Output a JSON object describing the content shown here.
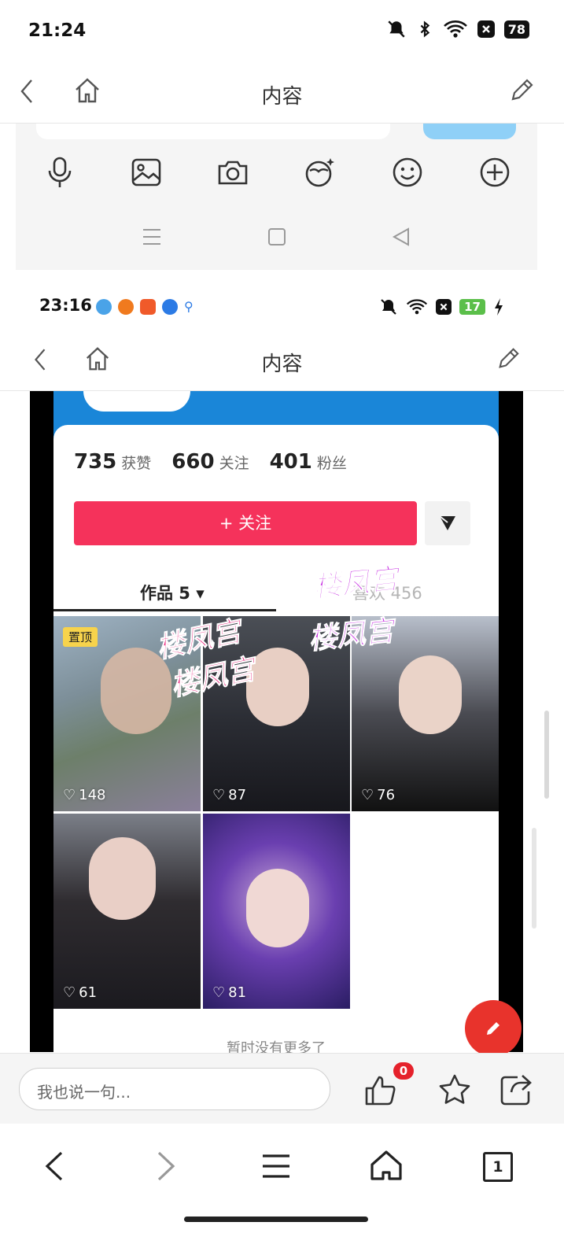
{
  "status_bar": {
    "time": "21:24",
    "battery": "78"
  },
  "top_nav": {
    "title": "内容"
  },
  "embedded_screenshot": {
    "status_bar": {
      "time": "23:16",
      "battery": "17"
    },
    "top_nav": {
      "title": "内容"
    },
    "profile": {
      "stats": [
        {
          "value": "735",
          "label": "获赞"
        },
        {
          "value": "660",
          "label": "关注"
        },
        {
          "value": "401",
          "label": "粉丝"
        }
      ],
      "follow_button": "+ 关注",
      "tabs": [
        {
          "label": "作品 5 ▾"
        },
        {
          "label": "喜欢 456"
        }
      ],
      "pinned_badge": "置顶",
      "videos": [
        {
          "likes": "148"
        },
        {
          "likes": "87"
        },
        {
          "likes": "76"
        },
        {
          "likes": "61"
        },
        {
          "likes": "81"
        }
      ],
      "no_more_text": "暂时没有更多了",
      "watermark": "楼凤宫"
    }
  },
  "comment_bar": {
    "placeholder": "我也说一句...",
    "like_count": "0"
  },
  "browser_bar": {
    "tab_count": "1"
  },
  "colors": {
    "accent_red": "#f5325b",
    "profile_blue": "#1a86d8",
    "badge_red": "#e5212b"
  }
}
